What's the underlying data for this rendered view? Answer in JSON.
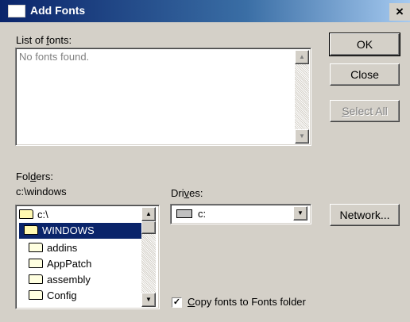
{
  "window": {
    "title": "Add Fonts",
    "close_glyph": "×"
  },
  "fonts": {
    "label": "List of fonts:",
    "label_pre": "List of ",
    "label_u": "f",
    "label_post": "onts:",
    "empty_text": "No fonts found."
  },
  "buttons": {
    "ok": "OK",
    "close": "Close",
    "select_all_u": "S",
    "select_all_post": "elect All",
    "network": "Network..."
  },
  "folders": {
    "label_pre": "Fol",
    "label_u": "d",
    "label_post": "ers:",
    "current_path": "c:\\windows",
    "items": [
      {
        "name": "c:\\",
        "icon": "open-folder-icon",
        "selected": false
      },
      {
        "name": "WINDOWS",
        "icon": "open-folder-icon",
        "selected": true
      },
      {
        "name": "addins",
        "icon": "folder-icon",
        "selected": false
      },
      {
        "name": "AppPatch",
        "icon": "folder-icon",
        "selected": false
      },
      {
        "name": "assembly",
        "icon": "folder-icon",
        "selected": false
      },
      {
        "name": "Config",
        "icon": "folder-icon",
        "selected": false
      }
    ]
  },
  "drives": {
    "label_pre": "Dri",
    "label_u": "v",
    "label_post": "es:",
    "selected": "c:",
    "icon": "drive-icon"
  },
  "copy_option": {
    "checked": true,
    "label_u": "C",
    "label_post": "opy fonts to Fonts folder"
  },
  "colors": {
    "selection": "#0a246a",
    "dialog_bg": "#d4d0c8"
  }
}
